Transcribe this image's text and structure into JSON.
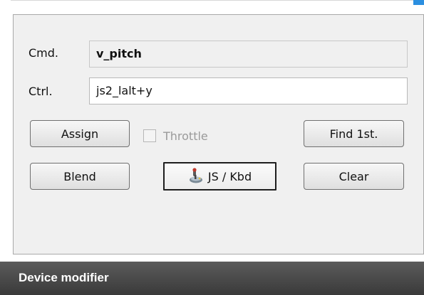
{
  "panel": {
    "cmd_label": "Cmd.",
    "cmd_value": "v_pitch",
    "ctrl_label": "Ctrl.",
    "ctrl_value": "js2_lalt+y"
  },
  "buttons": {
    "assign": "Assign",
    "find_first": "Find 1st.",
    "blend": "Blend",
    "js_kbd": "JS / Kbd",
    "clear": "Clear"
  },
  "throttle": {
    "label": "Throttle",
    "checked": false,
    "enabled": false
  },
  "icons": {
    "js_kbd_icon": "joystick-icon"
  },
  "footer": {
    "title": "Device modifier"
  },
  "colors": {
    "accent": "#2b8fe0",
    "footer_bg": "#4a4a4a",
    "panel_bg": "#f0f0f0"
  }
}
